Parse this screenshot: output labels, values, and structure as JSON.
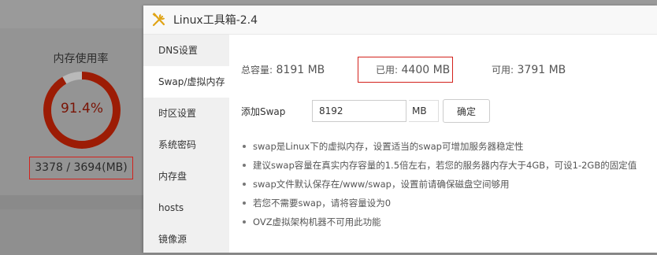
{
  "background": {
    "memory_title": "内存使用率",
    "memory_percent": "91.4%",
    "memory_percent_value": 91.4,
    "memory_detail": "3378 / 3694(MB)"
  },
  "dialog": {
    "title": "Linux工具箱-2.4",
    "app_icon": "tools-icon"
  },
  "sidebar": {
    "items": [
      {
        "label": "DNS设置"
      },
      {
        "label": "Swap/虚拟内存"
      },
      {
        "label": "时区设置"
      },
      {
        "label": "系统密码"
      },
      {
        "label": "内存盘"
      },
      {
        "label": "hosts"
      },
      {
        "label": "镜像源"
      }
    ],
    "active_index": 1
  },
  "swap": {
    "total_label": "总容量:",
    "total_value": "8191 MB",
    "used_label": "已用:",
    "used_value": "4400 MB",
    "available_label": "可用:",
    "available_value": "3791 MB",
    "input_label": "添加Swap",
    "input_value": "8192",
    "unit": "MB",
    "confirm_label": "确定",
    "tips": [
      "swap是Linux下的虚拟内存，设置适当的swap可增加服务器稳定性",
      "建议swap容量在真实内存容量的1.5倍左右，若您的服务器内存大于4GB，可设1-2GB的固定值",
      "swap文件默认保存在/www/swap，设置前请确保磁盘空间够用",
      "若您不需要swap，请将容量设为0",
      "OVZ虚拟架构机器不可用此功能"
    ]
  },
  "colors": {
    "gauge": "#9c1c05",
    "gauge_track": "#b9b9b9",
    "highlight_box": "#d3221c"
  }
}
